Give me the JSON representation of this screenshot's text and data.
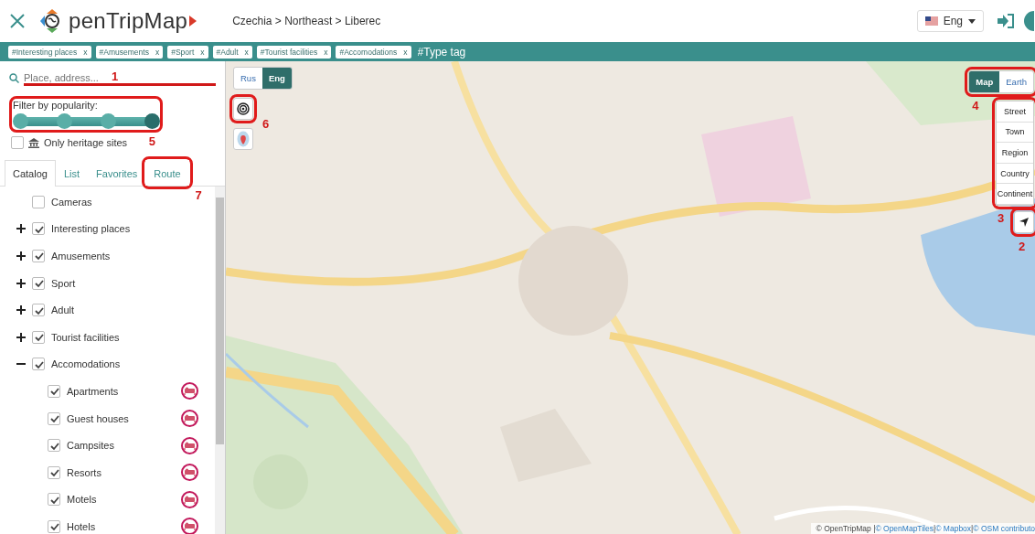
{
  "header": {
    "logo": "penTripMap",
    "breadcrumb": "Czechia > Northeast > Liberec",
    "language": "Eng"
  },
  "tags": [
    {
      "label": "#Interesting places",
      "remove": "x"
    },
    {
      "label": "#Amusements",
      "remove": "x"
    },
    {
      "label": "#Sport",
      "remove": "x"
    },
    {
      "label": "#Adult",
      "remove": "x"
    },
    {
      "label": "#Tourist facilities",
      "remove": "x"
    },
    {
      "label": "#Accomodations",
      "remove": "x"
    }
  ],
  "tag_input": {
    "placeholder": "#Type tag"
  },
  "sidebar": {
    "search": {
      "placeholder": "Place, address...",
      "annotation": {
        "kind": "underline",
        "label": "1"
      }
    },
    "popularity": {
      "label": "Filter by popularity:",
      "level": 1,
      "annotation": {
        "kind": "box",
        "label": "5"
      }
    },
    "heritage": {
      "label": "Only heritage sites",
      "checked": false
    },
    "tabs": [
      {
        "label": "Catalog",
        "selected": true
      },
      {
        "label": "List",
        "selected": false
      },
      {
        "label": "Favorites",
        "selected": false
      },
      {
        "label": "Route",
        "selected": false,
        "annotation": {
          "kind": "box",
          "label": "7"
        }
      }
    ],
    "catalog": [
      {
        "label": "Cameras",
        "checked": false
      },
      {
        "label": "Interesting places",
        "checked": true,
        "expanded": false
      },
      {
        "label": "Amusements",
        "checked": true,
        "expanded": false
      },
      {
        "label": "Sport",
        "checked": true,
        "expanded": false
      },
      {
        "label": "Adult",
        "checked": true,
        "expanded": false
      },
      {
        "label": "Tourist facilities",
        "checked": true,
        "expanded": false
      },
      {
        "label": "Accomodations",
        "checked": true,
        "expanded": true,
        "children": [
          {
            "label": "Apartments",
            "checked": true
          },
          {
            "label": "Guest houses",
            "checked": true
          },
          {
            "label": "Campsites",
            "checked": true
          },
          {
            "label": "Resorts",
            "checked": true
          },
          {
            "label": "Motels",
            "checked": true
          },
          {
            "label": "Hotels",
            "checked": true
          }
        ]
      }
    ]
  },
  "map": {
    "kind": "picture",
    "label_lang": [
      {
        "label": "Rus",
        "selected": false
      },
      {
        "label": "Eng",
        "selected": true
      }
    ],
    "radius_button": {
      "annotation": {
        "kind": "box",
        "label": "6"
      }
    },
    "map_type": {
      "options": [
        {
          "label": "Map",
          "selected": true
        },
        {
          "label": "Earth",
          "selected": false
        }
      ],
      "annotation": {
        "kind": "box",
        "label": "4"
      }
    },
    "zoom_levels": {
      "options": [
        "Street",
        "Town",
        "Region",
        "Country",
        "Continent"
      ],
      "annotation": {
        "kind": "box",
        "label": "3"
      }
    },
    "locate_button": {
      "annotation": {
        "kind": "box",
        "label": "2"
      }
    },
    "attribution": [
      {
        "text": "© OpenTripMap | ",
        "link": false
      },
      {
        "text": "© OpenMapTiles",
        "link": true
      },
      {
        "text": " | ",
        "link": false
      },
      {
        "text": "© Mapbox",
        "link": true
      },
      {
        "text": " | ",
        "link": false
      },
      {
        "text": "© OSM contributo",
        "link": true
      }
    ]
  }
}
